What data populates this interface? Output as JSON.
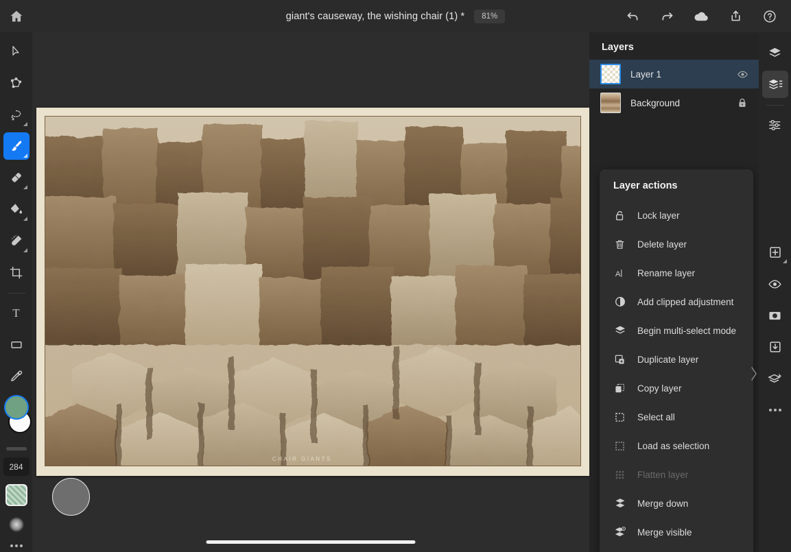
{
  "app": {
    "title": "giant's causeway, the wishing chair (1) *",
    "zoom": "81%"
  },
  "topbar": {
    "home_label": "home-icon",
    "actions": [
      {
        "name": "undo-icon",
        "label": "Undo"
      },
      {
        "name": "redo-icon",
        "label": "Redo"
      },
      {
        "name": "cloud-icon",
        "label": "Cloud documents"
      },
      {
        "name": "share-icon",
        "label": "Share"
      },
      {
        "name": "help-icon",
        "label": "Help"
      }
    ]
  },
  "tools": {
    "items": [
      {
        "name": "move-tool",
        "label": "Move",
        "active": false,
        "corner": false
      },
      {
        "name": "transform-tool",
        "label": "Transform",
        "active": false,
        "corner": false
      },
      {
        "name": "lasso-tool",
        "label": "Lasso select",
        "active": false,
        "corner": true
      },
      {
        "name": "brush-tool",
        "label": "Brush",
        "active": true,
        "corner": true
      },
      {
        "name": "eraser-tool",
        "label": "Eraser",
        "active": false,
        "corner": true
      },
      {
        "name": "fill-tool",
        "label": "Fill",
        "active": false,
        "corner": true
      },
      {
        "name": "heal-tool",
        "label": "Spot heal",
        "active": false,
        "corner": true
      },
      {
        "name": "crop-tool",
        "label": "Crop",
        "active": false,
        "corner": false
      },
      {
        "name": "type-tool",
        "label": "Type",
        "active": false,
        "corner": false
      },
      {
        "name": "shape-tool",
        "label": "Shape",
        "active": false,
        "corner": false
      },
      {
        "name": "eyedropper-tool",
        "label": "Eyedropper",
        "active": false,
        "corner": false
      }
    ],
    "brush_size": "284",
    "foreground_color": "#6fa182",
    "background_color": "#fbfbfb",
    "pattern_color": "#8fb89b"
  },
  "canvas": {
    "photo_caption": "CHAIR    GIANTS",
    "mount_color": "#eae2cd"
  },
  "layers": {
    "panel_title": "Layers",
    "rows": [
      {
        "name": "Layer 1",
        "selected": true,
        "thumb": "transparent",
        "right_icon": "eye-icon"
      },
      {
        "name": "Background",
        "selected": false,
        "thumb": "photo",
        "right_icon": "lock-icon"
      }
    ]
  },
  "layer_actions": {
    "title": "Layer actions",
    "items": [
      {
        "label": "Lock layer",
        "icon": "unlock-icon",
        "disabled": false
      },
      {
        "label": "Delete layer",
        "icon": "trash-icon",
        "disabled": false
      },
      {
        "label": "Rename layer",
        "icon": "rename-icon",
        "disabled": false
      },
      {
        "label": "Add clipped adjustment",
        "icon": "adjustment-icon",
        "disabled": false
      },
      {
        "label": "Begin multi-select mode",
        "icon": "layers-icon",
        "disabled": false
      },
      {
        "label": "Duplicate layer",
        "icon": "duplicate-icon",
        "disabled": false
      },
      {
        "label": "Copy layer",
        "icon": "copy-icon",
        "disabled": false
      },
      {
        "label": "Select all",
        "icon": "select-all-icon",
        "disabled": false
      },
      {
        "label": "Load as selection",
        "icon": "load-selection-icon",
        "disabled": false
      },
      {
        "label": "Flatten layer",
        "icon": "flatten-icon",
        "disabled": true
      },
      {
        "label": "Merge down",
        "icon": "merge-down-icon",
        "disabled": false
      },
      {
        "label": "Merge visible",
        "icon": "merge-visible-icon",
        "disabled": false
      }
    ]
  },
  "right_rail": {
    "items": [
      {
        "name": "layers-panel-icon",
        "label": "Layers",
        "active": false,
        "corner": false
      },
      {
        "name": "layer-properties-icon",
        "label": "Layer properties",
        "active": true,
        "corner": false
      },
      {
        "name": "adjustments-icon",
        "label": "Adjustments",
        "active": false,
        "corner": false
      },
      {
        "name": "add-layer-icon",
        "label": "Add layer",
        "active": false,
        "corner": true
      },
      {
        "name": "visibility-icon",
        "label": "Show / hide",
        "active": false,
        "corner": false
      },
      {
        "name": "mask-icon",
        "label": "Mask",
        "active": false,
        "corner": false
      },
      {
        "name": "import-icon",
        "label": "Import",
        "active": false,
        "corner": false
      },
      {
        "name": "transform-layer-icon",
        "label": "Transform layer",
        "active": false,
        "corner": false
      },
      {
        "name": "more-options-icon",
        "label": "More options",
        "active": false,
        "corner": false
      }
    ]
  }
}
